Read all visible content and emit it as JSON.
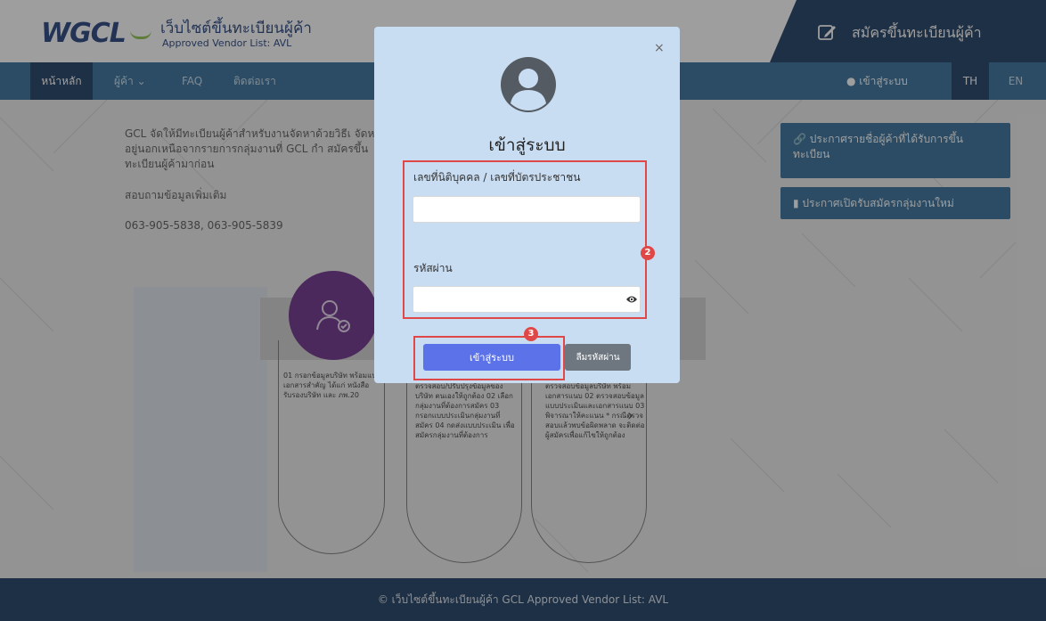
{
  "header": {
    "logo_text": "WGCL",
    "site_title": "เว็บไซต์ขึ้นทะเบียนผู้ค้า",
    "site_subtitle": "Approved Vendor List: AVL",
    "register_label": "สมัครขึ้นทะเบียนผู้ค้า",
    "register_icon": "edit-icon"
  },
  "nav": {
    "home": "หน้าหลัก",
    "vendor": "ผู้ค้า ⌄",
    "faq": "FAQ",
    "contact": "ติดต่อเรา",
    "login": "เข้าสู่ระบบ",
    "lang_th": "TH",
    "lang_en": "EN"
  },
  "main": {
    "intro": "GCL จัดให้มีทะเบียนผู้ค้าสำหรับงานจัดหาด้วยวิธีเ จัดหาที่อยู่นอกเหนือจากรายการกลุ่มงานที่ GCL กำ สมัครขึ้นทะเบียนผู้ค้ามาก่อน",
    "contact_label": "สอบถามข้อมูลเพิ่มเติม",
    "phones": "063-905-5838, 063-905-5839",
    "announce_1": "ประกาศรายชื่อผู้ค้าที่ได้รับการขึ้นทะเบียน",
    "announce_2": "ประกาศเปิดรับสมัครกลุ่มงานใหม่"
  },
  "steps": {
    "col1": "01 กรอกข้อมูลบริษัท พร้อมแนบเอกสารสำคัญ ได้แก่ หนังสือรับรองบริษัท และ ภพ.20",
    "col2": "ตรวจสอบ/ปรับปรุงข้อมูลของบริษัท ตนเองให้ถูกต้อง 02 เลือกกลุ่มงานที่ต้องการสมัคร 03 กรอกแบบประเมินกลุ่มงานที่สมัคร 04 กดส่งแบบประเมิน เพื่อสมัครกลุ่มงานที่ต้องการ",
    "col3": "ตรวจสอบข้อมูลบริษัท พร้อมเอกสารแนบ 02 ตรวจสอบข้อมูลแบบประเมินและเอกสารแนบ 03 พิจารณาให้คะแนน * กรณีตรวจสอบแล้วพบข้อผิดพลาด จะติดต่อผู้สมัครเพื่อแก้ไขให้ถูกต้อง"
  },
  "footer": {
    "text": "© เว็บไซต์ขึ้นทะเบียนผู้ค้า GCL Approved Vendor List: AVL"
  },
  "modal": {
    "close": "×",
    "title": "เข้าสู่ระบบ",
    "id_label": "เลขที่นิติบุคคล / เลขที่บัตรประชาชน",
    "id_value": "",
    "password_label": "รหัสผ่าน",
    "password_value": "",
    "login_button": "เข้าสู่ระบบ",
    "forgot_button": "ลืมรหัสผ่าน",
    "badge_2": "2",
    "badge_3": "3"
  },
  "colors": {
    "header_navy": "#17375e",
    "nav_blue": "#2e6b96",
    "modal_bg": "#c9ddf2",
    "login_button": "#5b72e8",
    "highlight_red": "#e04848"
  }
}
